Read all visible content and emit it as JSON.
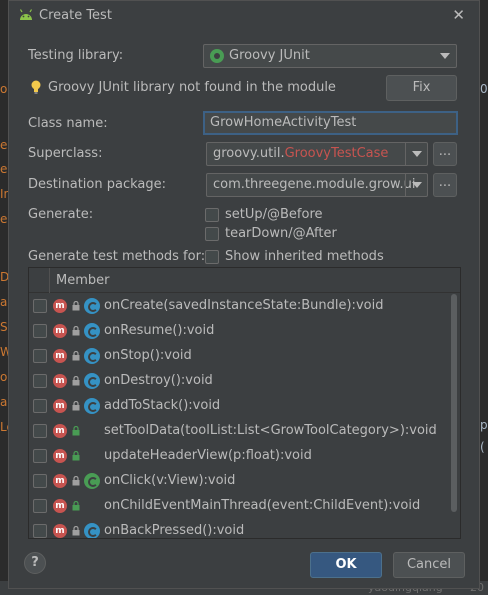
{
  "dialog": {
    "title": "Create Test",
    "testing_library_label": "Testing library:",
    "testing_library_value": "Groovy JUnit",
    "warning_text": "Groovy JUnit library not found in the module",
    "fix_button": "Fix",
    "class_name_label": "Class name:",
    "class_name_value": "GrowHomeActivityTest",
    "superclass_label": "Superclass:",
    "superclass_prefix": "groovy.util.",
    "superclass_error_part": "GroovyTestCase",
    "ellipsis": "...",
    "destination_label": "Destination package:",
    "destination_value": "com.threegene.module.grow.ui",
    "generate_label": "Generate:",
    "setup_label": "setUp/@Before",
    "teardown_label": "tearDown/@After",
    "generate_methods_label": "Generate test methods for:",
    "show_inherited_label": "Show inherited methods",
    "member_header": "Member",
    "members": [
      {
        "name": "onCreate(savedInstanceState:Bundle):void",
        "icon": "class-icon"
      },
      {
        "name": "onResume():void",
        "icon": "class-icon"
      },
      {
        "name": "onStop():void",
        "icon": "class-icon"
      },
      {
        "name": "onDestroy():void",
        "icon": "class-icon"
      },
      {
        "name": "addToStack():void",
        "icon": "class-icon"
      },
      {
        "name": "setToolData(toolList:List<GrowToolCategory>):void",
        "icon": ""
      },
      {
        "name": "updateHeaderView(p:float):void",
        "icon": ""
      },
      {
        "name": "onClick(v:View):void",
        "icon": "interface-icon"
      },
      {
        "name": "onChildEventMainThread(event:ChildEvent):void",
        "icon": ""
      },
      {
        "name": "onBackPressed():void",
        "icon": "class-icon"
      }
    ],
    "ok_button": "OK",
    "cancel_button": "Cancel",
    "help_button": "?"
  },
  "background": {
    "left_fragments": [
      "ou",
      "ew",
      "ew",
      "In",
      "ea",
      "Di",
      "ac",
      "Sc",
      "Wi",
      "ou",
      "ac",
      "Lo"
    ],
    "right_fragments": [
      "0",
      "p",
      "("
    ],
    "bottom_left": "yaodingqiang",
    "bottom_right": "20"
  },
  "colors": {
    "accent": "#365880",
    "error_text": "#c75450",
    "groovy_green": "#499c54",
    "class_blue": "#3592c4"
  }
}
